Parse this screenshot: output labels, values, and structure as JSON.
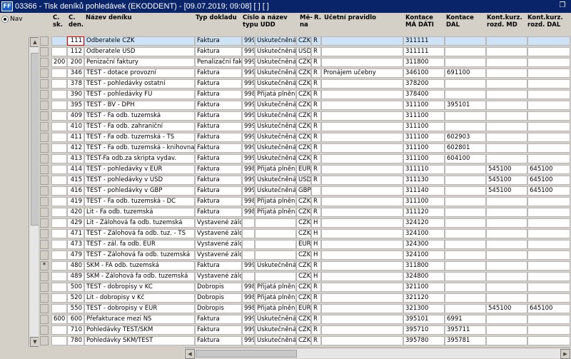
{
  "window": {
    "app_icon": "FF",
    "title": "03366 - Tisk deníků pohledávek (EKODDENT) - [09.07.2019; 09:08]  [ ]  [ ]",
    "restore_icon": "restore-icon"
  },
  "nav": {
    "label": "Nav",
    "selected": true
  },
  "columns": [
    {
      "key": "sk",
      "label": "Č.\nsk."
    },
    {
      "key": "den",
      "label": "Č.\nden."
    },
    {
      "key": "nazev",
      "label": "Název deníku"
    },
    {
      "key": "typ",
      "label": "Typ dokladu"
    },
    {
      "key": "udd",
      "label": "Číslo a název\ntypu UDD"
    },
    {
      "key": "mena",
      "label": "Mě-\nna"
    },
    {
      "key": "r",
      "label": "R."
    },
    {
      "key": "ucetni",
      "label": "Účetní pravidlo"
    },
    {
      "key": "md",
      "label": "Kontace\nMÁ DÁTI"
    },
    {
      "key": "dal",
      "label": "Kontace\nDAL"
    },
    {
      "key": "kmd",
      "label": "Kont.kurz.\nrozd. MD"
    },
    {
      "key": "kdal",
      "label": "Kont.kurz.\nrozd. DAL"
    }
  ],
  "rows": [
    {
      "sel": "",
      "sk": "",
      "den": "111",
      "nazev": "Odberatele CZK",
      "typ": "Faktura",
      "udd_n": "999",
      "udd_t": "Uskutečněná p",
      "mena": "CZK",
      "r": "R",
      "ucetni": "",
      "md": "311111",
      "dal": "",
      "kmd": "",
      "kdal": ""
    },
    {
      "sel": "",
      "sk": "",
      "den": "112",
      "nazev": "Odberatele USD",
      "typ": "Faktura",
      "udd_n": "999",
      "udd_t": "Uskutečněná p",
      "mena": "USD",
      "r": "R",
      "ucetni": "",
      "md": "311111",
      "dal": "",
      "kmd": "",
      "kdal": ""
    },
    {
      "sel": "",
      "sk": "200",
      "den": "200",
      "nazev": "Penizační faktury",
      "typ": "Penalizační faktura",
      "udd_n": "999",
      "udd_t": "Uskutečněná p",
      "mena": "CZK",
      "r": "R",
      "ucetni": "",
      "md": "311800",
      "dal": "",
      "kmd": "",
      "kdal": ""
    },
    {
      "sel": "",
      "sk": "",
      "den": "346",
      "nazev": "TEST - dotace provozní",
      "typ": "Faktura",
      "udd_n": "999",
      "udd_t": "Uskutečněná p",
      "mena": "CZK",
      "r": "R",
      "ucetni": "Pronájem učebny",
      "md": "346100",
      "dal": "691100",
      "kmd": "",
      "kdal": ""
    },
    {
      "sel": "",
      "sk": "",
      "den": "378",
      "nazev": "TEST - pohledávky ostatní",
      "typ": "Faktura",
      "udd_n": "999",
      "udd_t": "Uskutečněná p",
      "mena": "CZK",
      "r": "R",
      "ucetni": "",
      "md": "378200",
      "dal": "",
      "kmd": "",
      "kdal": ""
    },
    {
      "sel": "",
      "sk": "",
      "den": "390",
      "nazev": "TEST - pohledávky FÚ",
      "typ": "Faktura",
      "udd_n": "998",
      "udd_t": "Přijatá plnění z",
      "mena": "CZK",
      "r": "R",
      "ucetni": "",
      "md": "378400",
      "dal": "",
      "kmd": "",
      "kdal": ""
    },
    {
      "sel": "",
      "sk": "",
      "den": "395",
      "nazev": "TEST - BV - DPH",
      "typ": "Faktura",
      "udd_n": "999",
      "udd_t": "Uskutečněná p",
      "mena": "CZK",
      "r": "R",
      "ucetni": "",
      "md": "311100",
      "dal": "395101",
      "kmd": "",
      "kdal": ""
    },
    {
      "sel": "",
      "sk": "",
      "den": "409",
      "nazev": "TEST - Fa odb. tuzemská",
      "typ": "Faktura",
      "udd_n": "999",
      "udd_t": "Uskutečněná p",
      "mena": "CZK",
      "r": "R",
      "ucetni": "",
      "md": "311100",
      "dal": "",
      "kmd": "",
      "kdal": ""
    },
    {
      "sel": "",
      "sk": "",
      "den": "410",
      "nazev": "TEST - Fa odb. zahraniční",
      "typ": "Faktura",
      "udd_n": "999",
      "udd_t": "Uskutečněná p",
      "mena": "CZK",
      "r": "R",
      "ucetni": "",
      "md": "311100",
      "dal": "",
      "kmd": "",
      "kdal": ""
    },
    {
      "sel": "",
      "sk": "",
      "den": "411",
      "nazev": "TEST - Fa odb. tuzemská - TS",
      "typ": "Faktura",
      "udd_n": "999",
      "udd_t": "Uskutečněná p",
      "mena": "CZK",
      "r": "R",
      "ucetni": "",
      "md": "311100",
      "dal": "602903",
      "kmd": "",
      "kdal": ""
    },
    {
      "sel": "",
      "sk": "",
      "den": "412",
      "nazev": "TEST - Fa odb. tuzemská - knihovna",
      "typ": "Faktura",
      "udd_n": "999",
      "udd_t": "Uskutečněná p",
      "mena": "CZK",
      "r": "R",
      "ucetni": "",
      "md": "311100",
      "dal": "602801",
      "kmd": "",
      "kdal": ""
    },
    {
      "sel": "",
      "sk": "",
      "den": "413",
      "nazev": "TEST-Fa odb.za skripta vydav.",
      "typ": "Faktura",
      "udd_n": "999",
      "udd_t": "Uskutečněná p",
      "mena": "CZK",
      "r": "R",
      "ucetni": "",
      "md": "311100",
      "dal": "604100",
      "kmd": "",
      "kdal": ""
    },
    {
      "sel": "",
      "sk": "",
      "den": "414",
      "nazev": "TEST - pohledávky v EUR",
      "typ": "Faktura",
      "udd_n": "998",
      "udd_t": "Přijatá plnění z",
      "mena": "EUR",
      "r": "R",
      "ucetni": "",
      "md": "311110",
      "dal": "",
      "kmd": "545100",
      "kdal": "645100"
    },
    {
      "sel": "",
      "sk": "",
      "den": "415",
      "nazev": "TEST - pohledávky v USD",
      "typ": "Faktura",
      "udd_n": "999",
      "udd_t": "Uskutečněná p",
      "mena": "USD",
      "r": "R",
      "ucetni": "",
      "md": "311130",
      "dal": "",
      "kmd": "545100",
      "kdal": "645100"
    },
    {
      "sel": "",
      "sk": "",
      "den": "416",
      "nazev": "TEST - pohledávky v GBP",
      "typ": "Faktura",
      "udd_n": "999",
      "udd_t": "Uskutečněná p",
      "mena": "GBP",
      "r": "",
      "ucetni": "",
      "md": "311140",
      "dal": "",
      "kmd": "545100",
      "kdal": "645100"
    },
    {
      "sel": "",
      "sk": "",
      "den": "419",
      "nazev": "TEST - Fa odb. tuzemská - DČ",
      "typ": "Faktura",
      "udd_n": "998",
      "udd_t": "Přijatá plnění z",
      "mena": "CZK",
      "r": "R",
      "ucetni": "",
      "md": "311100",
      "dal": "",
      "kmd": "",
      "kdal": ""
    },
    {
      "sel": "",
      "sk": "",
      "den": "420",
      "nazev": "Lit - Fa odb. tuzemská",
      "typ": "Faktura",
      "udd_n": "998",
      "udd_t": "Přijatá plnění z",
      "mena": "CZK",
      "r": "R",
      "ucetni": "",
      "md": "311120",
      "dal": "",
      "kmd": "",
      "kdal": ""
    },
    {
      "sel": "",
      "sk": "",
      "den": "429",
      "nazev": "Lit - Zálohová fa odb. tuzemská",
      "typ": "Vystavené záloh",
      "udd_n": "",
      "udd_t": "",
      "mena": "CZK",
      "r": "H",
      "ucetni": "",
      "md": "324120",
      "dal": "",
      "kmd": "",
      "kdal": ""
    },
    {
      "sel": "",
      "sk": "",
      "den": "471",
      "nazev": "TEST - Zálohová fa odb. tuz. - TS",
      "typ": "Vystavené záloh",
      "udd_n": "",
      "udd_t": "",
      "mena": "CZK",
      "r": "H",
      "ucetni": "",
      "md": "324100",
      "dal": "",
      "kmd": "",
      "kdal": ""
    },
    {
      "sel": "",
      "sk": "",
      "den": "473",
      "nazev": "TEST - zál. fa odb. EUR",
      "typ": "Vystavené záloh",
      "udd_n": "",
      "udd_t": "",
      "mena": "EUR",
      "r": "H",
      "ucetni": "",
      "md": "324300",
      "dal": "",
      "kmd": "",
      "kdal": ""
    },
    {
      "sel": "",
      "sk": "",
      "den": "479",
      "nazev": "TEST - Zálohová fa odb. tuzemská",
      "typ": "Vystavené záloh",
      "udd_n": "",
      "udd_t": "",
      "mena": "CZK",
      "r": "H",
      "ucetni": "",
      "md": "324100",
      "dal": "",
      "kmd": "",
      "kdal": ""
    },
    {
      "sel": "*",
      "sk": "",
      "den": "480",
      "nazev": "SKM - FA odb. tuzemská",
      "typ": "Faktura",
      "udd_n": "999",
      "udd_t": "Uskutečněná p",
      "mena": "CZK",
      "r": "R",
      "ucetni": "",
      "md": "311800",
      "dal": "",
      "kmd": "",
      "kdal": ""
    },
    {
      "sel": "",
      "sk": "",
      "den": "489",
      "nazev": "SKM - Zálohová fa odb. tuzemská",
      "typ": "Vystavené záloh",
      "udd_n": "",
      "udd_t": "",
      "mena": "CZK",
      "r": "H",
      "ucetni": "",
      "md": "324800",
      "dal": "",
      "kmd": "",
      "kdal": ""
    },
    {
      "sel": "",
      "sk": "",
      "den": "500",
      "nazev": "TEST - dobropisy v KČ",
      "typ": "Dobropis",
      "udd_n": "998",
      "udd_t": "Přijatá plnění z",
      "mena": "CZK",
      "r": "R",
      "ucetni": "",
      "md": "321100",
      "dal": "",
      "kmd": "",
      "kdal": ""
    },
    {
      "sel": "",
      "sk": "",
      "den": "520",
      "nazev": "Lit - dobropisy v Kč",
      "typ": "Dobropis",
      "udd_n": "998",
      "udd_t": "Přijatá plnění z",
      "mena": "CZK",
      "r": "R",
      "ucetni": "",
      "md": "321120",
      "dal": "",
      "kmd": "",
      "kdal": ""
    },
    {
      "sel": "",
      "sk": "",
      "den": "550",
      "nazev": "TEST - dobropisy v EUR",
      "typ": "Dobropis",
      "udd_n": "998",
      "udd_t": "Přijatá plnění z",
      "mena": "EUR",
      "r": "R",
      "ucetni": "",
      "md": "321300",
      "dal": "",
      "kmd": "545100",
      "kdal": "645100"
    },
    {
      "sel": "",
      "sk": "600",
      "den": "600",
      "nazev": "Přefakturace mezi NS",
      "typ": "Faktura",
      "udd_n": "999",
      "udd_t": "Uskutečněná p",
      "mena": "CZK",
      "r": "R",
      "ucetni": "",
      "md": "395101",
      "dal": "6991",
      "kmd": "",
      "kdal": ""
    },
    {
      "sel": "",
      "sk": "",
      "den": "710",
      "nazev": "Pohledávky TEST/SKM",
      "typ": "Faktura",
      "udd_n": "999",
      "udd_t": "Uskutečněná p",
      "mena": "CZK",
      "r": "R",
      "ucetni": "",
      "md": "395710",
      "dal": "395711",
      "kmd": "",
      "kdal": ""
    },
    {
      "sel": "",
      "sk": "",
      "den": "780",
      "nazev": "Pohledávky SKM/TEST",
      "typ": "Faktura",
      "udd_n": "999",
      "udd_t": "Uskutečněná p",
      "mena": "CZK",
      "r": "R",
      "ucetni": "",
      "md": "395780",
      "dal": "395781",
      "kmd": "",
      "kdal": ""
    }
  ],
  "selected_row": 0,
  "colors": {
    "titlebar": "#0a246a",
    "selected_row": "#cfe3f7",
    "active_cell_border": "#e00000"
  }
}
